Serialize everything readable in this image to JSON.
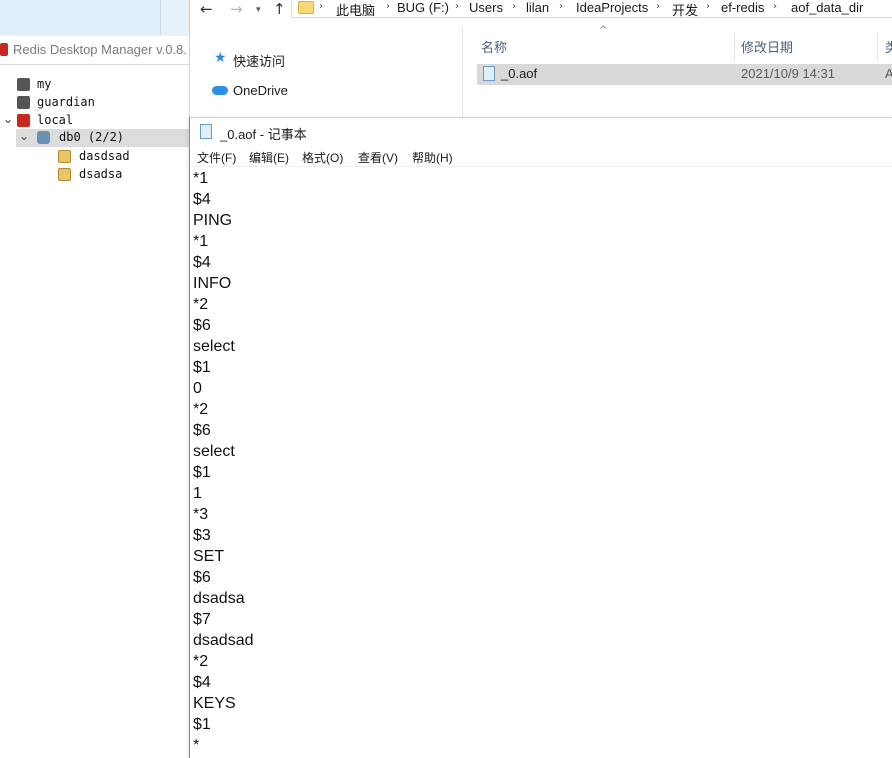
{
  "rdm": {
    "title": "Redis Desktop Manager v.0.8.",
    "tree": [
      {
        "label": "my"
      },
      {
        "label": "guardian"
      },
      {
        "label": "local"
      },
      {
        "label": "db0  (2/2)"
      },
      {
        "label": "dasdsad"
      },
      {
        "label": "dsadsa"
      }
    ]
  },
  "explorer": {
    "breadcrumb": [
      "此电脑",
      "BUG (F:)",
      "Users",
      "lilan",
      "IdeaProjects",
      "开发",
      "ef-redis",
      "aof_data_dir"
    ],
    "nav": {
      "quick_access": "快速访问",
      "onedrive": "OneDrive"
    },
    "columns": {
      "name": "名称",
      "modified": "修改日期",
      "type": "类"
    },
    "file": {
      "name": "_0.aof",
      "modified": "2021/10/9 14:31",
      "type": "A"
    }
  },
  "notepad": {
    "title": "_0.aof - 记事本",
    "menu": [
      "文件(F)",
      "编辑(E)",
      "格式(O)",
      "查看(V)",
      "帮助(H)"
    ],
    "lines": [
      "*1",
      "$4",
      "PING",
      "*1",
      "$4",
      "INFO",
      "*2",
      "$6",
      "select",
      "$1",
      "0",
      "*2",
      "$6",
      "select",
      "$1",
      "1",
      "*3",
      "$3",
      "SET",
      "$6",
      "dsadsa",
      "$7",
      "dsadsad",
      "*2",
      "$4",
      "KEYS",
      "$1",
      "*"
    ]
  }
}
